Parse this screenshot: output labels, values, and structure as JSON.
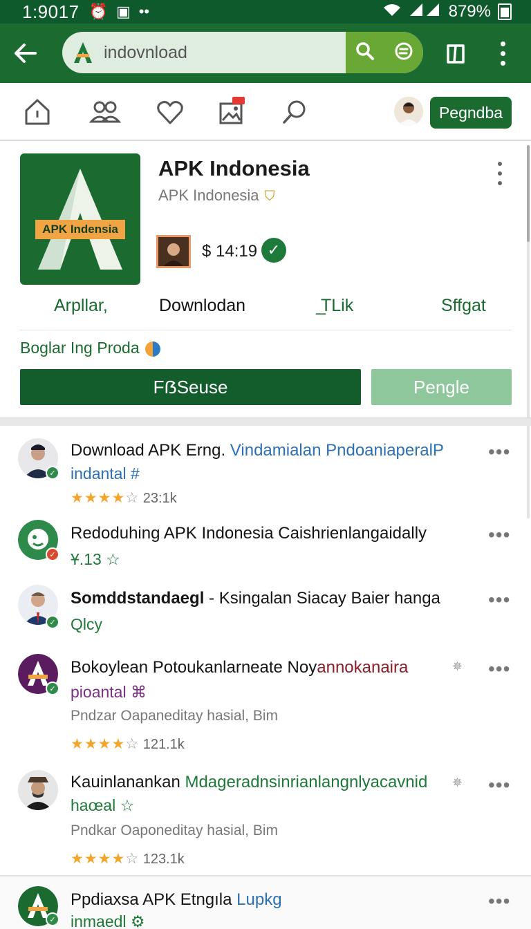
{
  "status_bar": {
    "time": "1:9017",
    "battery": "879%"
  },
  "search": {
    "value": "indovnload"
  },
  "nav": {
    "login_label": "Pegndba"
  },
  "app": {
    "title": "APK Indonesia",
    "developer": "APK Indonesia",
    "logo_label": "APK Indensia",
    "price": "$ 14:19",
    "tabs": [
      "Arpllar,",
      "Downlodan",
      "̲TLik",
      "Sffgat"
    ],
    "promo_text": "Boglar Ing Proda",
    "primary_button": "FẞSeuse",
    "secondary_button": "Pengle"
  },
  "colors": {
    "brand": "#1b6b31",
    "brand_dark": "#0f5a2c",
    "accent_light": "#8dc79b",
    "star": "#f2a52a"
  },
  "list": [
    {
      "title": "Download APK Erng.",
      "title_accent": " Vindamialan PndoaniaperalP",
      "sub": "indantal #",
      "stars": 4,
      "rating_count": "23:1k"
    },
    {
      "title": "Redoduhing APK Indonesia Caishrienlangaidally",
      "sub": "Ұ.13 ☆"
    },
    {
      "title": "Somddstandaegl",
      "title_rest": " - Ksingalan Siacay Baier hanga",
      "sub": "Qlcy"
    },
    {
      "title": "Bokoylean Potoukanlarneate Noy",
      "title_accent": "annokanaira",
      "sub": "pioantal ⌘",
      "desc": "Pndzar Oapaneditay hasial, Bim",
      "stars": 4,
      "rating_count": "121.1k"
    },
    {
      "title": "Kauinlanankan ",
      "title_accent": "Mdageradnsinrianlangnlyacavnid",
      "sub": "haœal ☆",
      "desc": "Pndkar Oaponeditay hasial, Bim",
      "stars": 4,
      "rating_count": "123.1k"
    },
    {
      "title": "Ppdiaxsa APK Etngıla ",
      "title_accent": "Lupkg",
      "sub": "inmaedl ⚙"
    }
  ]
}
